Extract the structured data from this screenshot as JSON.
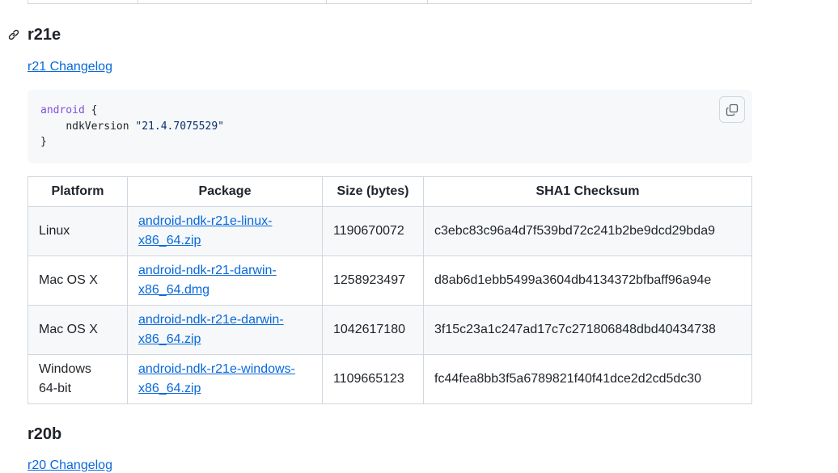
{
  "prev_section": {},
  "section_r21e": {
    "heading": "r21e",
    "changelog_link": "r21 Changelog",
    "code": {
      "keyword": "android",
      "open_brace": " {",
      "indent": "    ",
      "property": "ndkVersion ",
      "value": "\"21.4.7075529\"",
      "close_brace": "}"
    }
  },
  "table": {
    "headers": [
      "Platform",
      "Package",
      "Size (bytes)",
      "SHA1 Checksum"
    ],
    "rows": [
      {
        "platform": "Linux",
        "package": "android-ndk-r21e-linux-x86_64.zip",
        "package_line1": "android-ndk-r21e-linux-",
        "package_line2": "x86_64.zip",
        "size": "1190670072",
        "sha1": "c3ebc83c96a4d7f539bd72c241b2be9dcd29bda9"
      },
      {
        "platform": "Mac OS X",
        "package": "android-ndk-r21-darwin-x86_64.dmg",
        "package_line1": "android-ndk-r21-darwin-",
        "package_line2": "x86_64.dmg",
        "size": "1258923497",
        "sha1": "d8ab6d1ebb5499a3604db4134372bfbaff96a94e"
      },
      {
        "platform": "Mac OS X",
        "package": "android-ndk-r21e-darwin-x86_64.zip",
        "package_line1": "android-ndk-r21e-darwin-",
        "package_line2": "x86_64.zip",
        "size": "1042617180",
        "sha1": "3f15c23a1c247ad17c7c271806848dbd40434738"
      },
      {
        "platform_line1": "Windows",
        "platform_line2": "64-bit",
        "package": "android-ndk-r21e-windows-x86_64.zip",
        "package_line1": "android-ndk-r21e-windows-",
        "package_line2": "x86_64.zip",
        "size": "1109665123",
        "sha1": "fc44fea8bb3f5a6789821f40f41dce2d2cd5dc30"
      }
    ]
  },
  "section_r20b": {
    "heading": "r20b",
    "changelog_link": "r20 Changelog"
  },
  "icons": {
    "anchor": "link-icon",
    "copy": "copy-icon"
  },
  "colors": {
    "link": "#0969da",
    "border": "#d0d7de",
    "code_bg": "#f6f8fa",
    "keyword": "#8250df",
    "string": "#0a3069"
  }
}
